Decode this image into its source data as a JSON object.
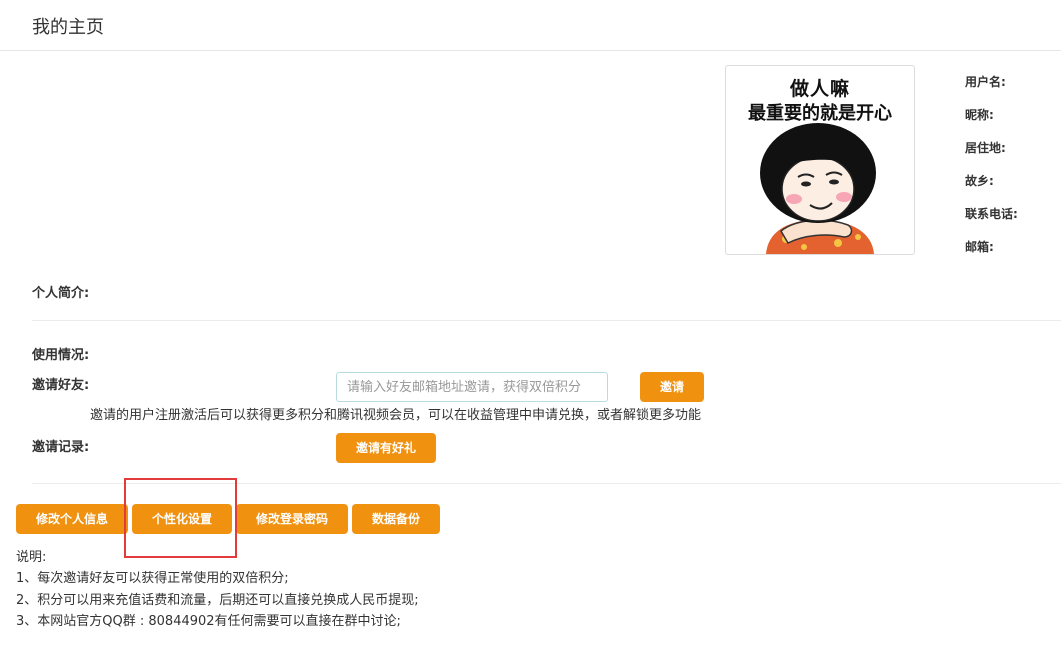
{
  "header": {
    "title": "我的主页"
  },
  "avatar": {
    "line1": "做人嘛",
    "line2": "最重要的就是开心"
  },
  "profile": {
    "username_label": "用户名:",
    "nickname_label": "昵称:",
    "residence_label": "居住地:",
    "hometown_label": "故乡:",
    "phone_label": "联系电话:",
    "email_label": "邮箱:"
  },
  "bio": {
    "label": "个人简介:"
  },
  "usage": {
    "label": "使用情况:"
  },
  "invite": {
    "label": "邀请好友:",
    "placeholder": "请输入好友邮箱地址邀请，获得双倍积分",
    "button": "邀请",
    "description": "邀请的用户注册激活后可以获得更多积分和腾讯视频会员，可以在收益管理中申请兑换，或者解锁更多功能"
  },
  "invite_record": {
    "label": "邀请记录:",
    "button": "邀请有好礼"
  },
  "actions": {
    "edit_profile": "修改个人信息",
    "personalize": "个性化设置",
    "change_password": "修改登录密码",
    "data_backup": "数据备份"
  },
  "notes": {
    "title": "说明:",
    "items": [
      "1、每次邀请好友可以获得正常使用的双倍积分;",
      "2、积分可以用来充值话费和流量，后期还可以直接兑换成人民币提现;",
      "3、本网站官方QQ群 : 80844902有任何需要可以直接在群中讨论;"
    ]
  },
  "colors": {
    "accent": "#f0910f",
    "highlight": "#e33b3b"
  }
}
